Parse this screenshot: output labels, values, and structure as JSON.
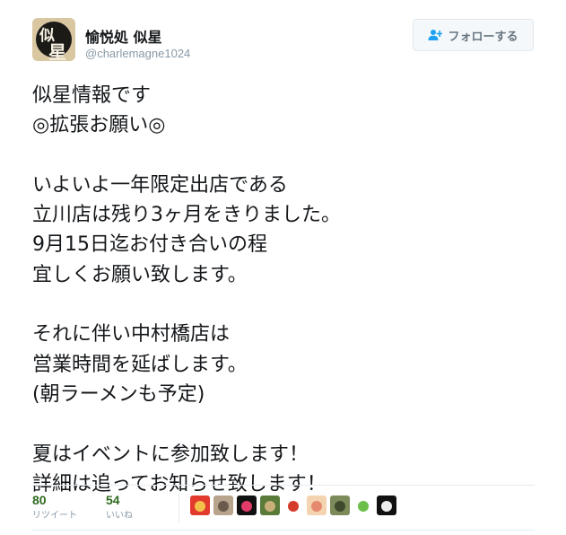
{
  "user": {
    "display_name": "愉悦処 似星",
    "screen_name": "@charlemagne1024",
    "avatar_glyphs": [
      "似",
      "星"
    ]
  },
  "follow_button": {
    "label": "フォローする",
    "icon": "add-user-icon"
  },
  "tweet": {
    "lines": [
      "似星情報です",
      "◎拡張お願い◎",
      "",
      "いよいよ一年限定出店である",
      "立川店は残り3ヶ月をきりました。",
      "9月15日迄お付き合いの程",
      "宜しくお願い致します。",
      "",
      "それに伴い中村橋店は",
      "営業時間を延ばします。",
      "(朝ラーメンも予定)",
      "",
      "夏はイベントに参加致します！",
      "詳細は追ってお知らせ致します！"
    ]
  },
  "stats": {
    "retweets": {
      "value": "80",
      "label": "リツイート"
    },
    "likes": {
      "value": "54",
      "label": "いいね"
    }
  },
  "liker_avatars": [
    {
      "name": "avatar-1",
      "colors": [
        "#e23b2e",
        "#f3c14a"
      ]
    },
    {
      "name": "avatar-2",
      "colors": [
        "#b8a38d",
        "#6a5a4c"
      ]
    },
    {
      "name": "avatar-3",
      "colors": [
        "#111111",
        "#e23b6a"
      ]
    },
    {
      "name": "avatar-4",
      "colors": [
        "#5a7a3a",
        "#c9b07a"
      ]
    },
    {
      "name": "avatar-5",
      "colors": [
        "#ffffff",
        "#d43b2a"
      ]
    },
    {
      "name": "avatar-6",
      "colors": [
        "#f4d3b0",
        "#e58a6e"
      ]
    },
    {
      "name": "avatar-7",
      "colors": [
        "#7d8a5a",
        "#3e4a2c"
      ]
    },
    {
      "name": "avatar-8",
      "colors": [
        "#ffffff",
        "#6cc04a"
      ]
    },
    {
      "name": "avatar-9",
      "colors": [
        "#111111",
        "#eeeeee"
      ]
    }
  ],
  "colors": {
    "text": "#14171a",
    "secondary": "#8899a6",
    "stat_value": "#2f6a1f",
    "border": "#e6ecf0"
  }
}
